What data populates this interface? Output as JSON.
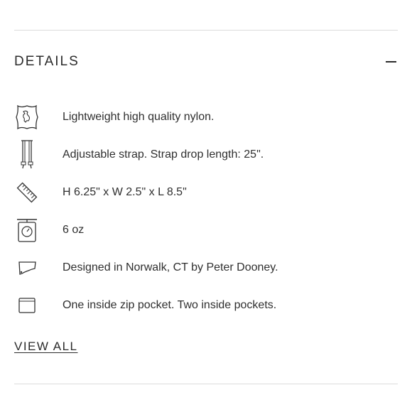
{
  "section": {
    "title": "DETAILS",
    "toggle_icon": "minus-icon"
  },
  "details": [
    {
      "icon": "leather-hide-icon",
      "text": "Lightweight high quality nylon."
    },
    {
      "icon": "strap-icon",
      "text": "Adjustable strap. Strap drop length: 25\"."
    },
    {
      "icon": "ruler-icon",
      "text": "H 6.25\" x W 2.5\" x L 8.5\""
    },
    {
      "icon": "scale-icon",
      "text": "6 oz"
    },
    {
      "icon": "connecticut-map-icon",
      "text": "Designed in Norwalk, CT by Peter Dooney."
    },
    {
      "icon": "pocket-icon",
      "text": "One inside zip pocket. Two inside pockets."
    }
  ],
  "view_all_label": "VIEW ALL"
}
